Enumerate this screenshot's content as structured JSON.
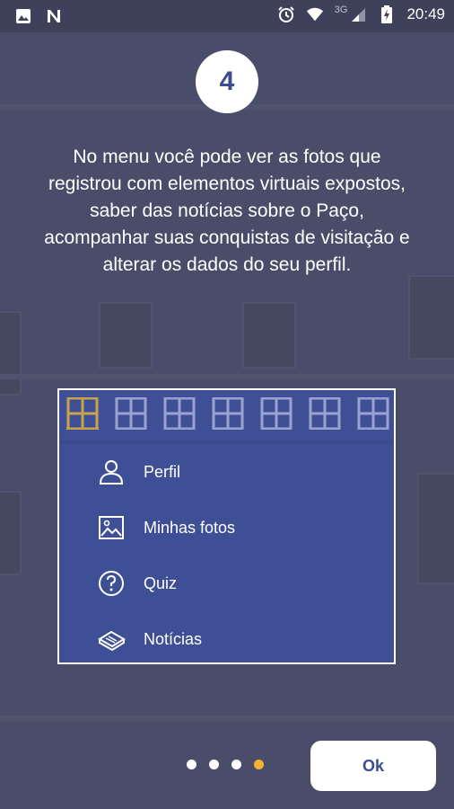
{
  "status_bar": {
    "time": "20:49",
    "network": "3G",
    "icons": [
      "image-icon",
      "n-icon",
      "alarm-icon",
      "wifi-icon",
      "signal-icon",
      "battery-charging-icon"
    ]
  },
  "step": {
    "number": "4"
  },
  "description": "No menu você pode ver as fotos que registrou com elementos virtuais expostos, saber das notícias sobre o Paço, acompanhar suas conquistas de visitação e alterar os dados do seu perfil.",
  "menu": {
    "window_icons": {
      "count": 7,
      "active_index": 0
    },
    "items": [
      {
        "label": "Perfil",
        "icon": "user-icon"
      },
      {
        "label": "Minhas fotos",
        "icon": "photo-icon"
      },
      {
        "label": "Quiz",
        "icon": "question-icon"
      },
      {
        "label": "Notícias",
        "icon": "newspaper-icon"
      }
    ]
  },
  "pager": {
    "total": 4,
    "active": 4
  },
  "ok_button": {
    "label": "Ok"
  },
  "colors": {
    "background": "#4a4d69",
    "accent": "#3d4b8f",
    "menu_bg": "#3f4f95",
    "active_dot": "#f2b233"
  }
}
